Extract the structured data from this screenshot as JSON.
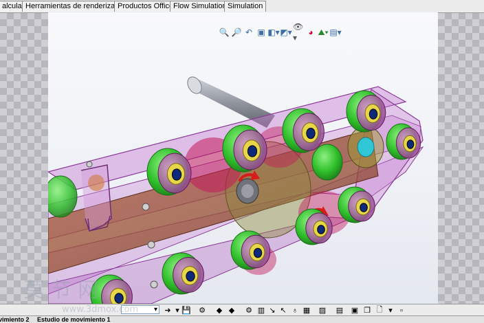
{
  "tabs": [
    {
      "label": "alcular"
    },
    {
      "label": "Herramientas de renderizado"
    },
    {
      "label": "Productos Office"
    },
    {
      "label": "Flow Simulation"
    },
    {
      "label": "Simulation"
    }
  ],
  "heads_up_icons": [
    "zoom-to-fit-icon",
    "zoom-area-icon",
    "previous-view-icon",
    "section-view-icon",
    "view-orientation-icon",
    "display-style-icon",
    "hide-show-icon",
    "edit-appearance-icon",
    "apply-scene-icon",
    "view-settings-icon"
  ],
  "motion_toolbar": {
    "time_value": "",
    "icons": [
      "calculate-icon",
      "play-icon",
      "stop-icon",
      "save-animation-icon",
      "motor-icon",
      "spring-icon",
      "contact-icon",
      "gravity-icon",
      "results-icon",
      "study-properties-icon"
    ]
  },
  "status_tabs": [
    {
      "label": "vimiento 2"
    },
    {
      "label": "Estudio de movimiento 1"
    }
  ],
  "watermark": {
    "text": "莫 节 网",
    "url": "www.3dmox.com"
  },
  "colors": {
    "frame_purple": "#b04fc0",
    "roller_green": "#39c435",
    "plate_brown": "#9e4b2f",
    "highlight_cyan": "#2fc6d6",
    "arrow_red": "#d81b1b"
  }
}
